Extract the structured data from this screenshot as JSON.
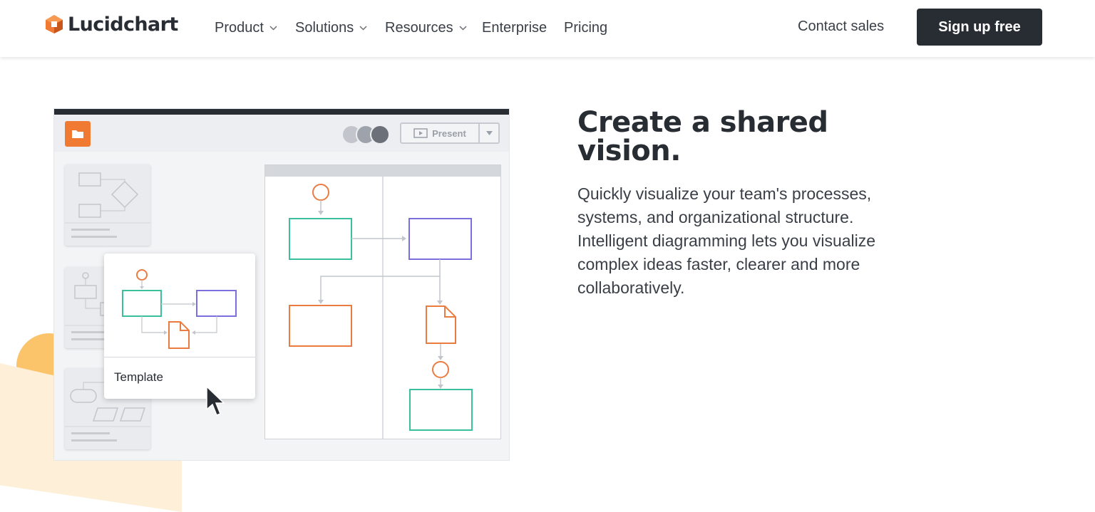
{
  "header": {
    "brand": "Lucidchart",
    "nav": [
      {
        "label": "Product",
        "dropdown": true
      },
      {
        "label": "Solutions",
        "dropdown": true
      },
      {
        "label": "Resources",
        "dropdown": true
      },
      {
        "label": "Enterprise",
        "dropdown": false
      },
      {
        "label": "Pricing",
        "dropdown": false
      }
    ],
    "contact_label": "Contact sales",
    "signup_label": "Sign up free"
  },
  "illustration": {
    "present_label": "Present",
    "template_label": "Template"
  },
  "feature": {
    "headline_line1": "Create a shared",
    "headline_line2": "vision.",
    "body": "Quickly visualize your team's processes, systems, and organizational structure. Intelligent diagramming lets you visualize complex ideas faster, clearer and more collaboratively."
  },
  "colors": {
    "brand_orange": "#f07a32",
    "dark": "#282c33",
    "teal": "#3cbf9f",
    "purple": "#7b6fde",
    "shape_orange": "#ea7c42",
    "deco_yellow": "#fcc46a",
    "deco_cream": "#fef0d8"
  }
}
